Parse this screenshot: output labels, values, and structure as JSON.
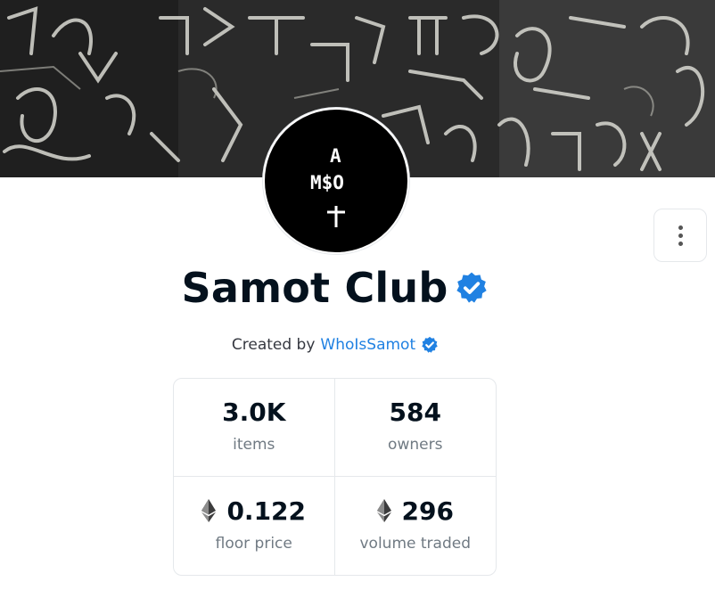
{
  "collection": {
    "name": "Samot Club",
    "avatar_text": [
      "A",
      "M$O",
      "T"
    ],
    "verified": true
  },
  "creator": {
    "prefix": "Created by",
    "name": "WhoIsSamot",
    "verified": true
  },
  "stats": [
    {
      "value": "3.0K",
      "label": "items",
      "currency_icon": null
    },
    {
      "value": "584",
      "label": "owners",
      "currency_icon": null
    },
    {
      "value": "0.122",
      "label": "floor price",
      "currency_icon": "ethereum-icon"
    },
    {
      "value": "296",
      "label": "volume traded",
      "currency_icon": "ethereum-icon"
    }
  ],
  "menu": {
    "icon": "more-vertical-icon"
  },
  "colors": {
    "link": "#2081e2",
    "verified": "#2081e2",
    "text": "#04111d",
    "muted": "#707a83",
    "border": "#e5e8eb"
  }
}
